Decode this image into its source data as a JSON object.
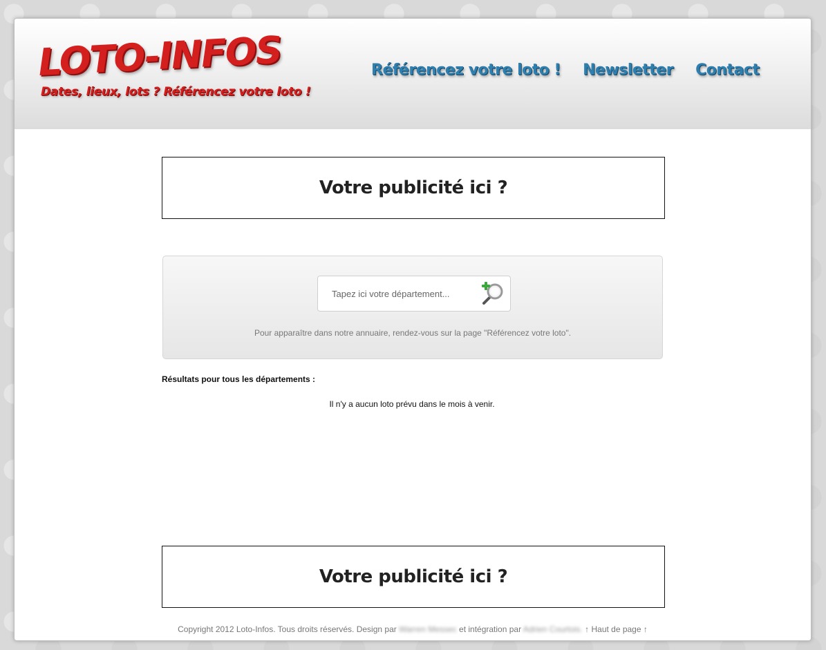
{
  "logo": {
    "title": "LOTO-INFOS",
    "tagline": "Dates, lieux, lots ? Référencez votre loto !"
  },
  "nav": {
    "items": [
      {
        "label": "Référencez votre loto !"
      },
      {
        "label": "Newsletter"
      },
      {
        "label": "Contact"
      }
    ]
  },
  "ads": {
    "top_label": "Votre publicité ici ?",
    "bottom_label": "Votre publicité ici ?"
  },
  "search": {
    "placeholder": "Tapez ici votre département...",
    "value": "",
    "note": "Pour apparaître dans notre annuaire, rendez-vous sur la page \"Référencez votre loto\"."
  },
  "results": {
    "heading": "Résultats pour tous les départements :",
    "empty_message": "Il n'y a aucun loto prévu dans le mois à venir."
  },
  "footer": {
    "copyright": "Copyright 2012 Loto-Infos. Tous droits réservés. Design par",
    "designer": "Warren Messec",
    "integration_text": "et intégration par",
    "integrator": "Adrien Courtois.",
    "back_to_top": "↑ Haut de page ↑"
  },
  "colors": {
    "logo_red": "#d41f1f",
    "nav_blue": "#2e7fae"
  }
}
